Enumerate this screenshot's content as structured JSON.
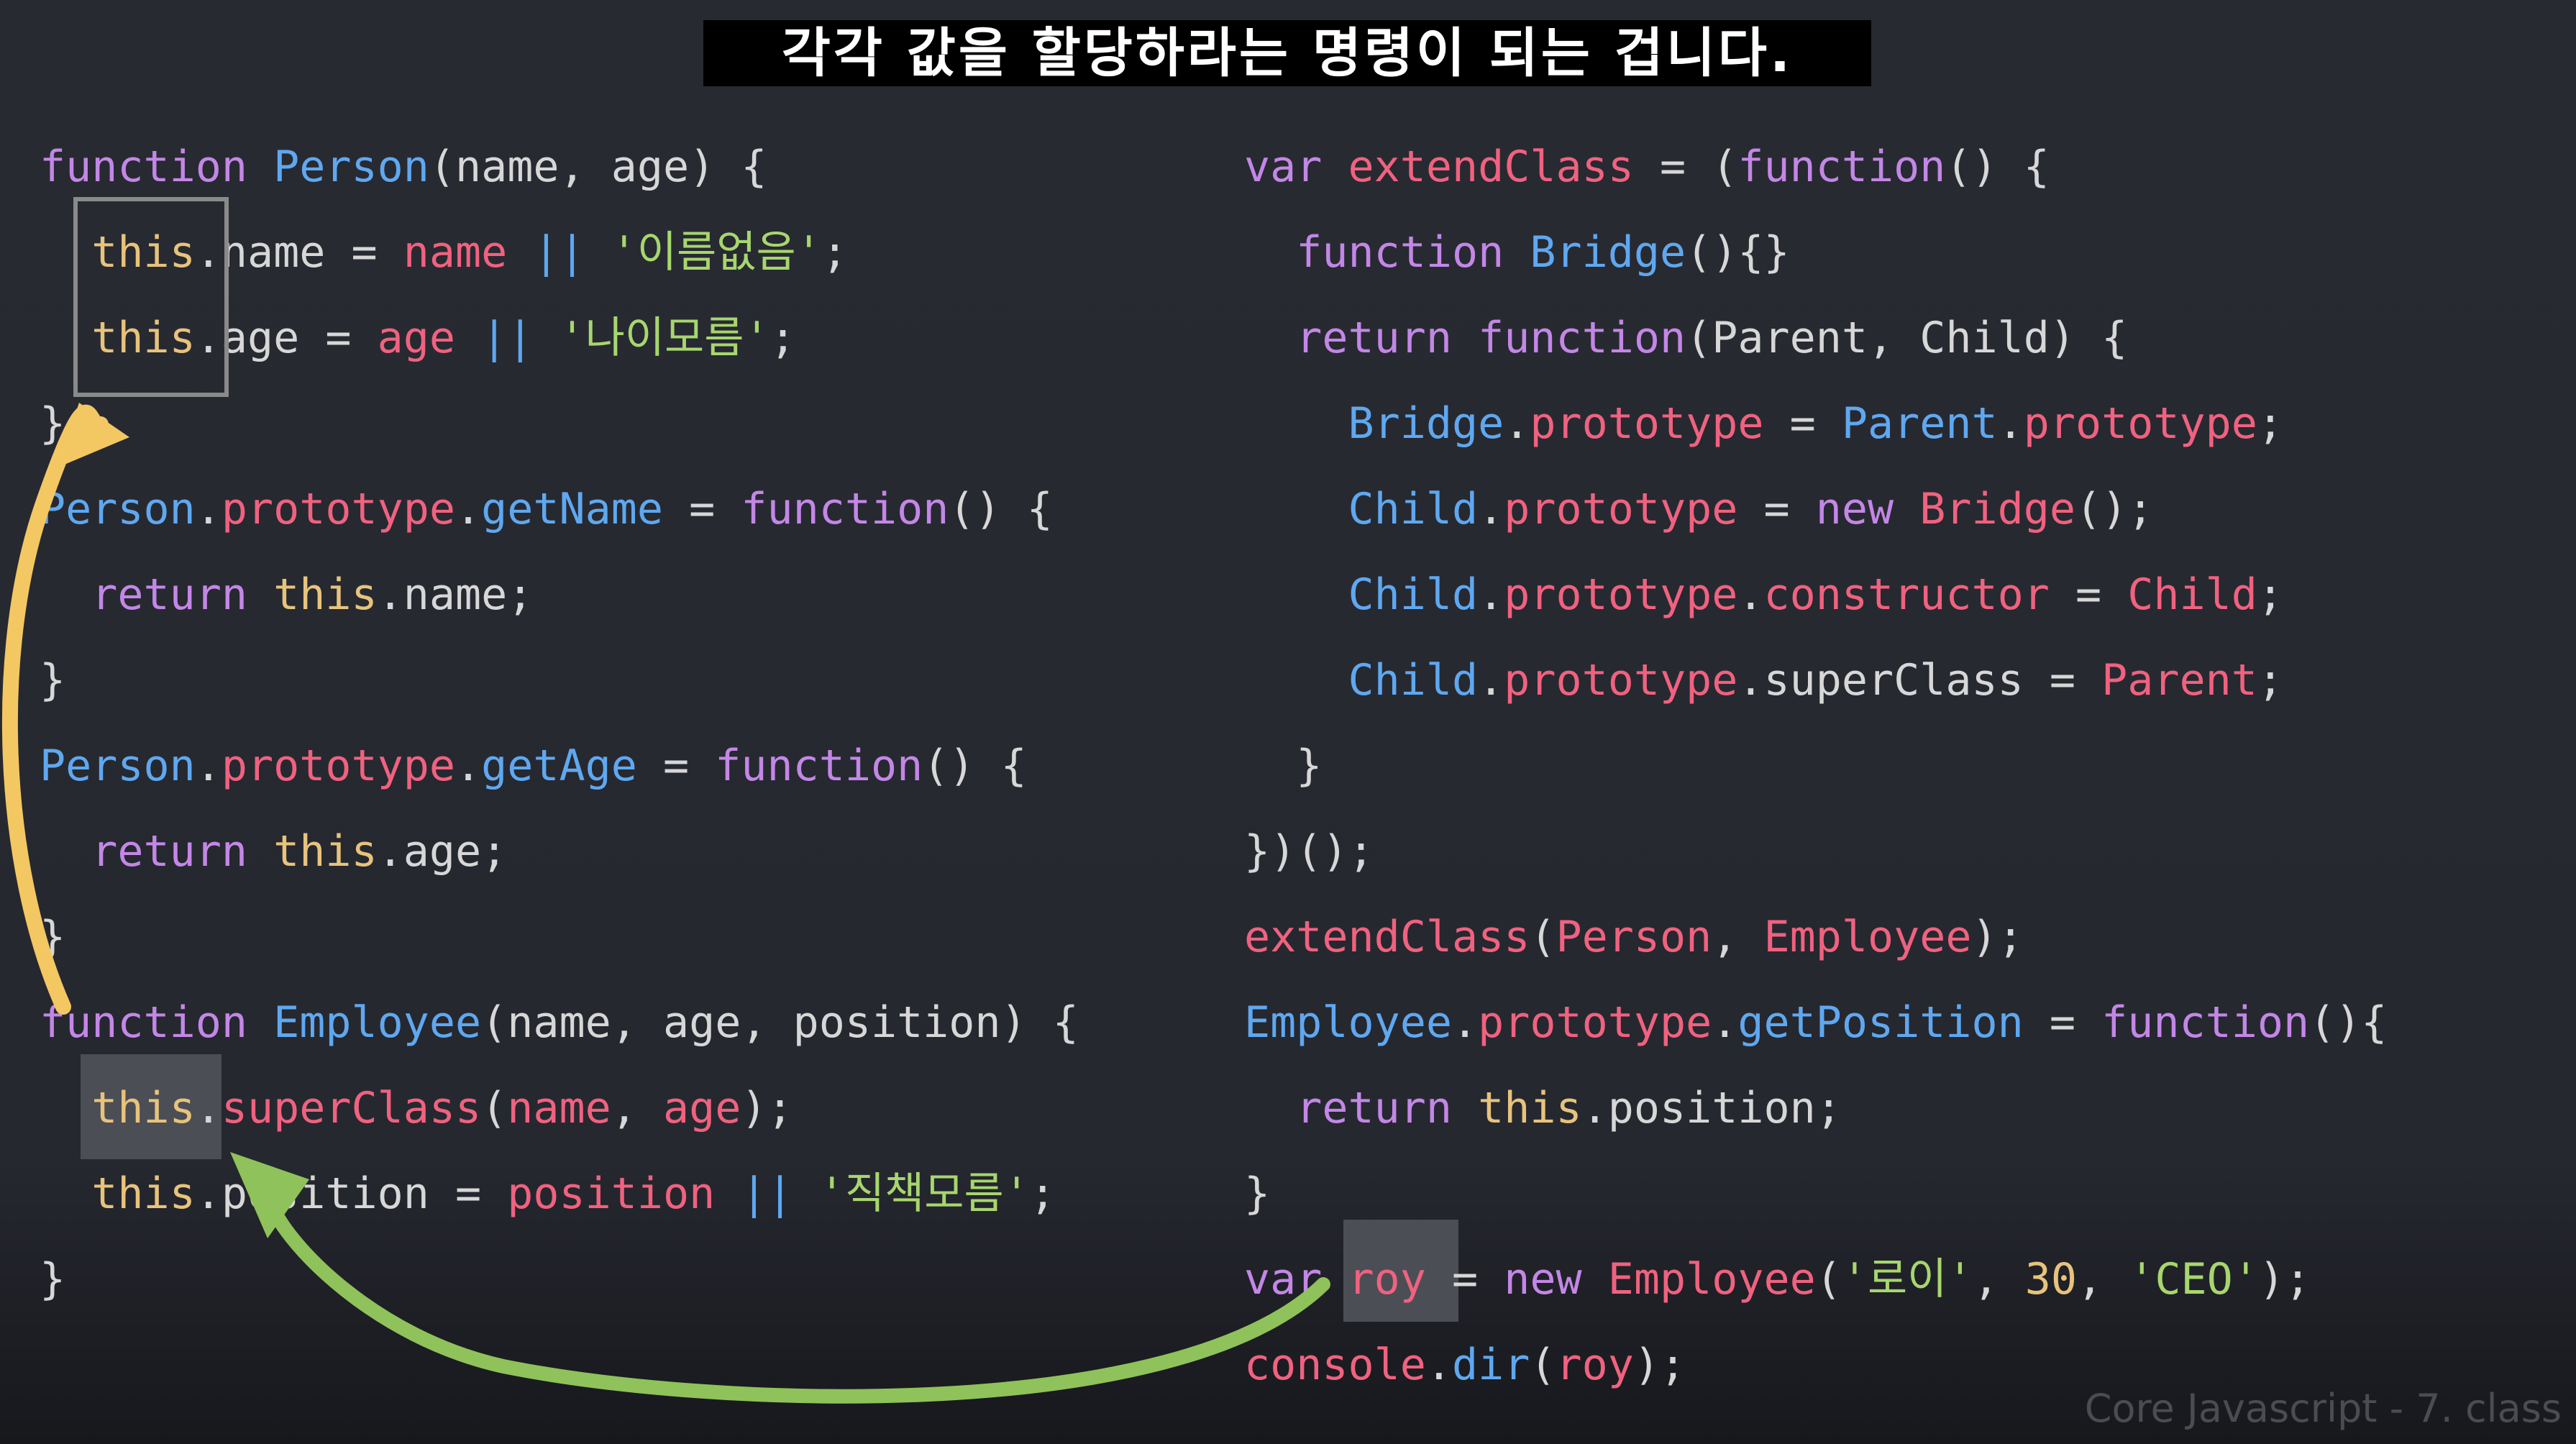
{
  "subtitle": "각각 값을 할당하라는 명령이 되는 겁니다.",
  "watermark": "Core Javascript - 7. class",
  "colors": {
    "keyword": "#c387e6",
    "function": "#5fa8f0",
    "identifier": "#f0627f",
    "string": "#a7d66e",
    "this": "#e7c37c",
    "arrow_yellow": "#f3c762",
    "arrow_green": "#8fc25a"
  },
  "left_code": [
    [
      {
        "t": "function ",
        "c": "k"
      },
      {
        "t": "Person",
        "c": "f"
      },
      {
        "t": "(name, age) {",
        "c": "w"
      }
    ],
    [
      {
        "t": "  ",
        "c": "w"
      },
      {
        "t": "this",
        "c": "y"
      },
      {
        "t": ".name = ",
        "c": "w"
      },
      {
        "t": "name",
        "c": "r"
      },
      {
        "t": " ",
        "c": "w"
      },
      {
        "t": "||",
        "c": "op"
      },
      {
        "t": " ",
        "c": "w"
      },
      {
        "t": "'이름없음'",
        "c": "s"
      },
      {
        "t": ";",
        "c": "w"
      }
    ],
    [
      {
        "t": "  ",
        "c": "w"
      },
      {
        "t": "this",
        "c": "y"
      },
      {
        "t": ".age = ",
        "c": "w"
      },
      {
        "t": "age",
        "c": "r"
      },
      {
        "t": " ",
        "c": "w"
      },
      {
        "t": "||",
        "c": "op"
      },
      {
        "t": " ",
        "c": "w"
      },
      {
        "t": "'나이모름'",
        "c": "s"
      },
      {
        "t": ";",
        "c": "w"
      }
    ],
    [
      {
        "t": "}",
        "c": "w"
      }
    ],
    [
      {
        "t": "Person",
        "c": "f"
      },
      {
        "t": ".",
        "c": "w"
      },
      {
        "t": "prototype",
        "c": "r"
      },
      {
        "t": ".",
        "c": "w"
      },
      {
        "t": "getName",
        "c": "f"
      },
      {
        "t": " = ",
        "c": "w"
      },
      {
        "t": "function",
        "c": "k"
      },
      {
        "t": "() {",
        "c": "w"
      }
    ],
    [
      {
        "t": "  ",
        "c": "w"
      },
      {
        "t": "return ",
        "c": "k"
      },
      {
        "t": "this",
        "c": "y"
      },
      {
        "t": ".name;",
        "c": "w"
      }
    ],
    [
      {
        "t": "}",
        "c": "w"
      }
    ],
    [
      {
        "t": "Person",
        "c": "f"
      },
      {
        "t": ".",
        "c": "w"
      },
      {
        "t": "prototype",
        "c": "r"
      },
      {
        "t": ".",
        "c": "w"
      },
      {
        "t": "getAge",
        "c": "f"
      },
      {
        "t": " = ",
        "c": "w"
      },
      {
        "t": "function",
        "c": "k"
      },
      {
        "t": "() {",
        "c": "w"
      }
    ],
    [
      {
        "t": "  ",
        "c": "w"
      },
      {
        "t": "return ",
        "c": "k"
      },
      {
        "t": "this",
        "c": "y"
      },
      {
        "t": ".age;",
        "c": "w"
      }
    ],
    [
      {
        "t": "}",
        "c": "w"
      }
    ],
    [
      {
        "t": "function ",
        "c": "k"
      },
      {
        "t": "Employee",
        "c": "f"
      },
      {
        "t": "(name, age, position) {",
        "c": "w"
      }
    ],
    [
      {
        "t": "  ",
        "c": "w"
      },
      {
        "t": "this",
        "c": "y"
      },
      {
        "t": ".",
        "c": "w"
      },
      {
        "t": "superClass",
        "c": "r"
      },
      {
        "t": "(",
        "c": "w"
      },
      {
        "t": "name",
        "c": "r"
      },
      {
        "t": ", ",
        "c": "w"
      },
      {
        "t": "age",
        "c": "r"
      },
      {
        "t": ");",
        "c": "w"
      }
    ],
    [
      {
        "t": "  ",
        "c": "w"
      },
      {
        "t": "this",
        "c": "y"
      },
      {
        "t": ".position = ",
        "c": "w"
      },
      {
        "t": "position",
        "c": "r"
      },
      {
        "t": " ",
        "c": "w"
      },
      {
        "t": "||",
        "c": "op"
      },
      {
        "t": " ",
        "c": "w"
      },
      {
        "t": "'직책모름'",
        "c": "s"
      },
      {
        "t": ";",
        "c": "w"
      }
    ],
    [
      {
        "t": "}",
        "c": "w"
      }
    ]
  ],
  "right_code": [
    [
      {
        "t": "var ",
        "c": "k"
      },
      {
        "t": "extendClass",
        "c": "r"
      },
      {
        "t": " = (",
        "c": "w"
      },
      {
        "t": "function",
        "c": "k"
      },
      {
        "t": "() {",
        "c": "w"
      }
    ],
    [
      {
        "t": "  ",
        "c": "w"
      },
      {
        "t": "function ",
        "c": "k"
      },
      {
        "t": "Bridge",
        "c": "f"
      },
      {
        "t": "(){}",
        "c": "w"
      }
    ],
    [
      {
        "t": "  ",
        "c": "w"
      },
      {
        "t": "return ",
        "c": "k"
      },
      {
        "t": "function",
        "c": "k"
      },
      {
        "t": "(Parent, Child) {",
        "c": "w"
      }
    ],
    [
      {
        "t": "    ",
        "c": "w"
      },
      {
        "t": "Bridge",
        "c": "f"
      },
      {
        "t": ".",
        "c": "w"
      },
      {
        "t": "prototype",
        "c": "r"
      },
      {
        "t": " = ",
        "c": "w"
      },
      {
        "t": "Parent",
        "c": "f"
      },
      {
        "t": ".",
        "c": "w"
      },
      {
        "t": "prototype",
        "c": "r"
      },
      {
        "t": ";",
        "c": "w"
      }
    ],
    [
      {
        "t": "    ",
        "c": "w"
      },
      {
        "t": "Child",
        "c": "f"
      },
      {
        "t": ".",
        "c": "w"
      },
      {
        "t": "prototype",
        "c": "r"
      },
      {
        "t": " = ",
        "c": "w"
      },
      {
        "t": "new ",
        "c": "k"
      },
      {
        "t": "Bridge",
        "c": "r"
      },
      {
        "t": "();",
        "c": "w"
      }
    ],
    [
      {
        "t": "    ",
        "c": "w"
      },
      {
        "t": "Child",
        "c": "f"
      },
      {
        "t": ".",
        "c": "w"
      },
      {
        "t": "prototype",
        "c": "r"
      },
      {
        "t": ".",
        "c": "w"
      },
      {
        "t": "constructor",
        "c": "r"
      },
      {
        "t": " = ",
        "c": "w"
      },
      {
        "t": "Child",
        "c": "r"
      },
      {
        "t": ";",
        "c": "w"
      }
    ],
    [
      {
        "t": "    ",
        "c": "w"
      },
      {
        "t": "Child",
        "c": "f"
      },
      {
        "t": ".",
        "c": "w"
      },
      {
        "t": "prototype",
        "c": "r"
      },
      {
        "t": ".superClass = ",
        "c": "w"
      },
      {
        "t": "Parent",
        "c": "r"
      },
      {
        "t": ";",
        "c": "w"
      }
    ],
    [
      {
        "t": "  }",
        "c": "w"
      }
    ],
    [
      {
        "t": "})();",
        "c": "w"
      }
    ],
    [
      {
        "t": "extendClass",
        "c": "r"
      },
      {
        "t": "(",
        "c": "w"
      },
      {
        "t": "Person",
        "c": "r"
      },
      {
        "t": ", ",
        "c": "w"
      },
      {
        "t": "Employee",
        "c": "r"
      },
      {
        "t": ");",
        "c": "w"
      }
    ],
    [
      {
        "t": "Employee",
        "c": "f"
      },
      {
        "t": ".",
        "c": "w"
      },
      {
        "t": "prototype",
        "c": "r"
      },
      {
        "t": ".",
        "c": "w"
      },
      {
        "t": "getPosition",
        "c": "f"
      },
      {
        "t": " = ",
        "c": "w"
      },
      {
        "t": "function",
        "c": "k"
      },
      {
        "t": "(){",
        "c": "w"
      }
    ],
    [
      {
        "t": "  ",
        "c": "w"
      },
      {
        "t": "return ",
        "c": "k"
      },
      {
        "t": "this",
        "c": "y"
      },
      {
        "t": ".position;",
        "c": "w"
      }
    ],
    [
      {
        "t": "}",
        "c": "w"
      }
    ],
    [
      {
        "t": "var ",
        "c": "k"
      },
      {
        "t": "roy",
        "c": "r"
      },
      {
        "t": " = ",
        "c": "w"
      },
      {
        "t": "new ",
        "c": "k"
      },
      {
        "t": "Employee",
        "c": "r"
      },
      {
        "t": "(",
        "c": "w"
      },
      {
        "t": "'로이'",
        "c": "s"
      },
      {
        "t": ", ",
        "c": "w"
      },
      {
        "t": "30",
        "c": "y"
      },
      {
        "t": ", ",
        "c": "w"
      },
      {
        "t": "'CEO'",
        "c": "s"
      },
      {
        "t": ");",
        "c": "w"
      }
    ],
    [
      {
        "t": "console",
        "c": "r"
      },
      {
        "t": ".",
        "c": "w"
      },
      {
        "t": "dir",
        "c": "f"
      },
      {
        "t": "(",
        "c": "w"
      },
      {
        "t": "roy",
        "c": "r"
      },
      {
        "t": ");",
        "c": "w"
      }
    ]
  ]
}
